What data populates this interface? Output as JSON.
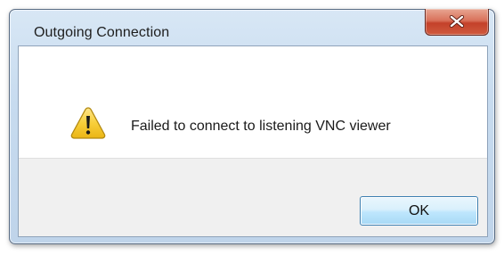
{
  "window": {
    "title": "Outgoing Connection"
  },
  "titlebar": {
    "close_icon": "close-icon",
    "close_color": "#c4412a"
  },
  "dialog": {
    "icon": "warning-icon",
    "icon_color": "#f5c518",
    "message": "Failed to connect to listening VNC viewer"
  },
  "buttons": {
    "ok_label": "OK"
  }
}
